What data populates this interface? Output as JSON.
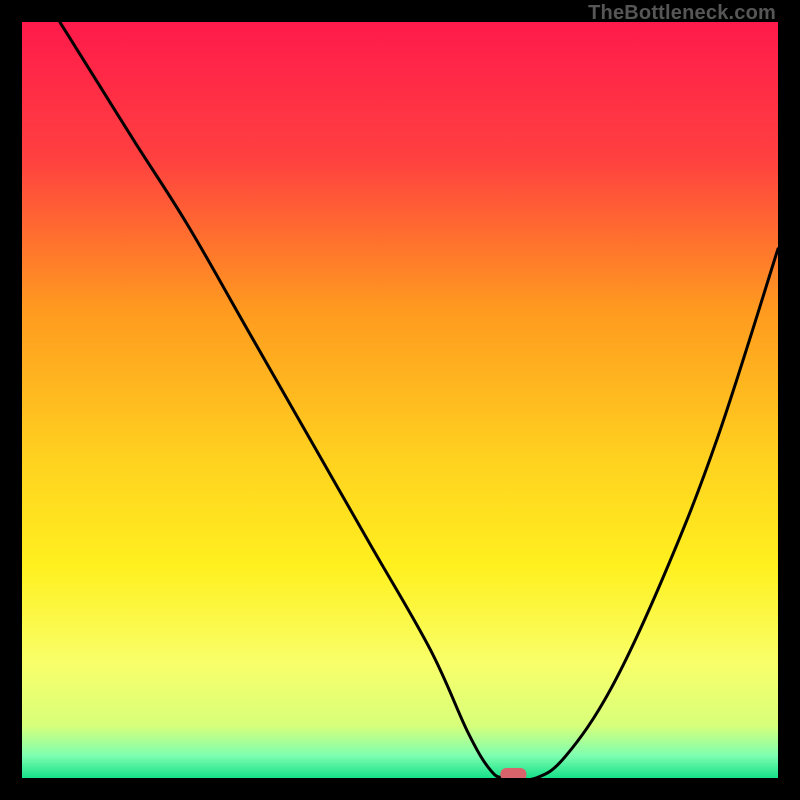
{
  "watermark": "TheBottleneck.com",
  "chart_data": {
    "type": "line",
    "title": "",
    "xlabel": "",
    "ylabel": "",
    "xlim": [
      0,
      100
    ],
    "ylim": [
      0,
      100
    ],
    "grid": false,
    "background": "spectral-gradient-red-to-green",
    "series": [
      {
        "name": "bottleneck-curve",
        "x": [
          5,
          10,
          15,
          22,
          30,
          38,
          46,
          54,
          59,
          62,
          64,
          68,
          72,
          78,
          85,
          92,
          100
        ],
        "values": [
          100,
          92,
          84,
          73,
          59,
          45,
          31,
          17,
          6,
          1,
          0,
          0,
          3,
          12,
          27,
          45,
          70
        ]
      }
    ],
    "minimum_marker": {
      "x": 65,
      "y": 0
    },
    "gradient_stops": [
      {
        "offset": 0,
        "color": "#ff1a4b"
      },
      {
        "offset": 18,
        "color": "#ff4040"
      },
      {
        "offset": 38,
        "color": "#ff9a1f"
      },
      {
        "offset": 58,
        "color": "#ffd21f"
      },
      {
        "offset": 72,
        "color": "#fff01f"
      },
      {
        "offset": 85,
        "color": "#f8ff6a"
      },
      {
        "offset": 93,
        "color": "#d8ff7a"
      },
      {
        "offset": 97,
        "color": "#7fffb0"
      },
      {
        "offset": 100,
        "color": "#16e08a"
      }
    ]
  }
}
